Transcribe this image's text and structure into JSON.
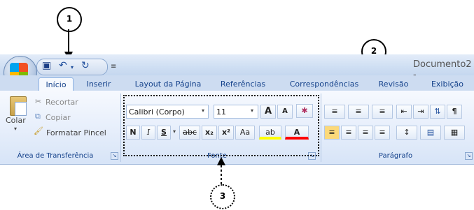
{
  "callouts": {
    "one": "1",
    "two": "2",
    "three": "3"
  },
  "window": {
    "title": "Documento2 -"
  },
  "tabs": [
    "Início",
    "Inserir",
    "Layout da Página",
    "Referências",
    "Correspondências",
    "Revisão",
    "Exibição"
  ],
  "clipboard": {
    "paste_label": "Colar",
    "cut_label": "Recortar",
    "copy_label": "Copiar",
    "format_painter_label": "Formatar Pincel",
    "group_label": "Área de Transferência"
  },
  "font": {
    "font_name": "Calibri (Corpo)",
    "font_size": "11",
    "grow_label": "A",
    "shrink_label": "A",
    "bold_label": "N",
    "italic_label": "I",
    "underline_label": "S",
    "strike_label": "abc",
    "subscript_label": "x₂",
    "superscript_label": "x²",
    "case_label": "Aa",
    "highlight_label": "ab",
    "color_label": "A",
    "group_label": "Fonte"
  },
  "paragraph": {
    "group_label": "Parágrafo"
  },
  "colors": {
    "accent": "#15428b",
    "ribbon": "#e6eefb"
  }
}
